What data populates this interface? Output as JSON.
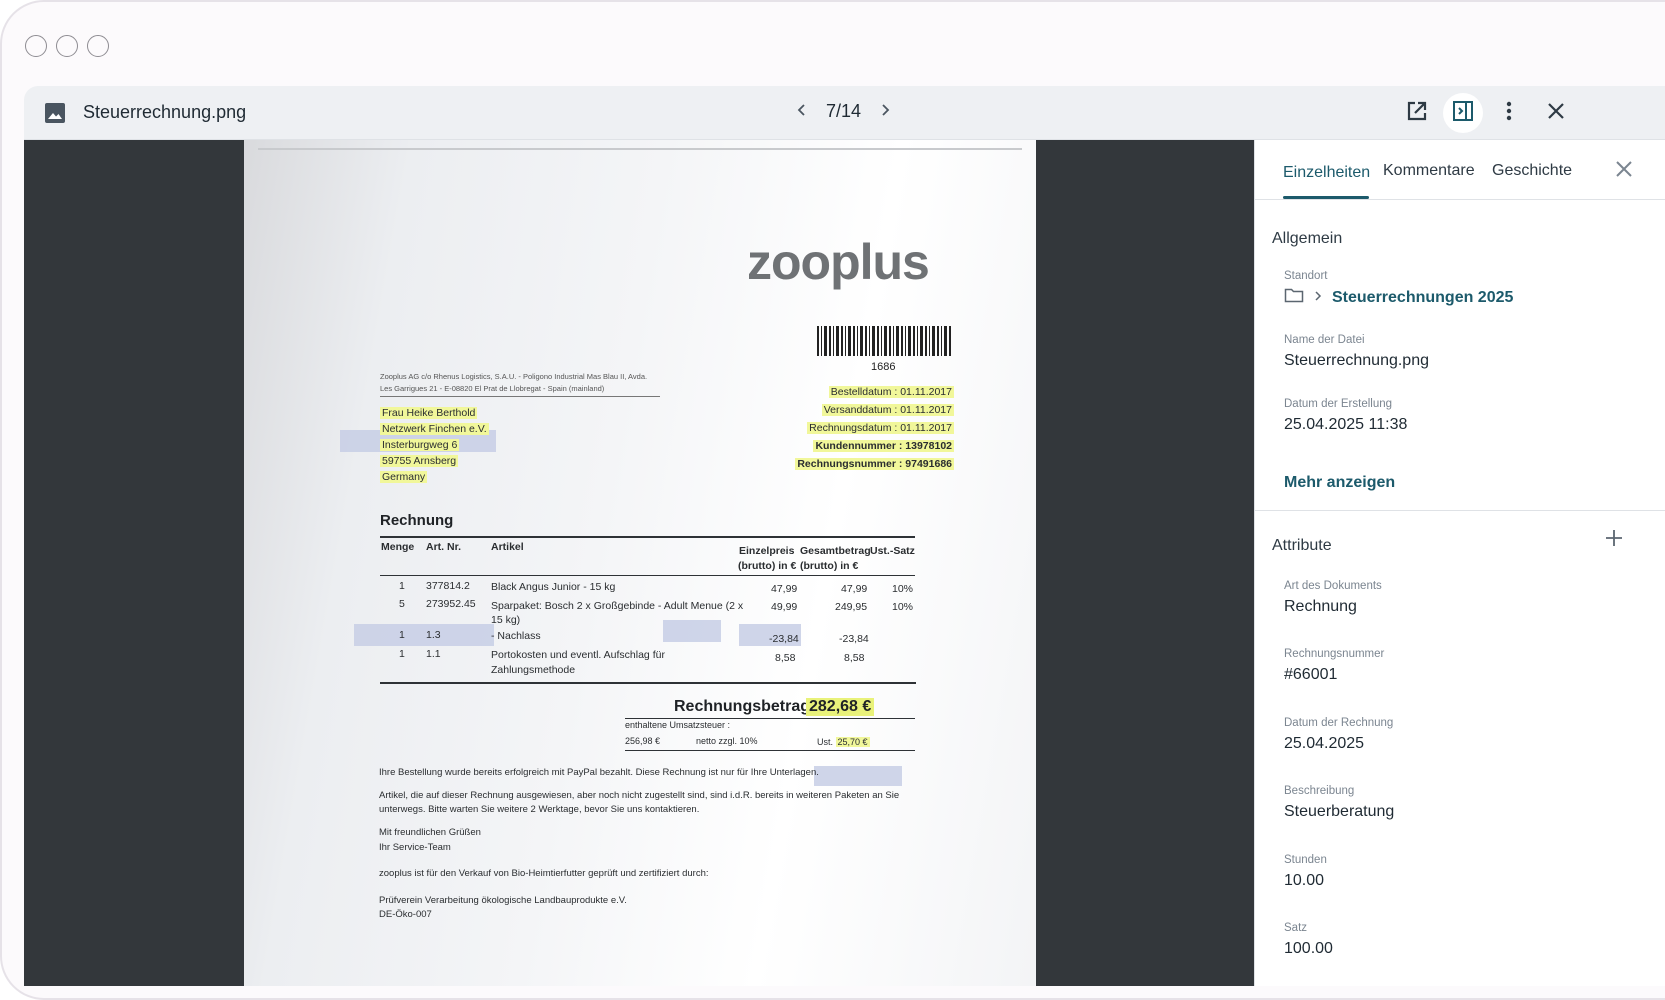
{
  "window": {
    "file_name": "Steuerrechnung.png",
    "pager": "7/14",
    "icons": [
      "image-icon",
      "chevron-left-icon",
      "chevron-right-icon",
      "open-external-icon",
      "sidebar-panel-icon",
      "more-vertical-icon",
      "close-icon"
    ]
  },
  "document": {
    "logo_text": "zooplus",
    "barcode_number": "1686",
    "sender_line1": "Zooplus AG c/o Rhenus Logistics, S.A.U. - Poligono Industrial Mas Blau II, Avda.",
    "sender_line2": "Les Garrigues 21 - E-08820 El Prat de Llobregat - Spain (mainland)",
    "address": [
      "Frau Heike Berthold",
      "Netzwerk Finchen e.V.",
      "Insterburgweg 6",
      "59755 Arnsberg",
      "Germany"
    ],
    "meta": [
      {
        "label": "Bestelldatum :",
        "value": "01.11.2017"
      },
      {
        "label": "Versanddatum :",
        "value": "01.11.2017"
      },
      {
        "label": "Rechnungsdatum :",
        "value": "01.11.2017"
      },
      {
        "label": "Kundennummer :",
        "value": "13978102"
      },
      {
        "label": "Rechnungsnummer :",
        "value": "97491686"
      }
    ],
    "heading": "Rechnung",
    "table_headers": [
      "Menge",
      "Art. Nr.",
      "Artikel",
      "Einzelpreis",
      "(brutto) in €",
      "Gesamtbetrag",
      "(brutto) in €",
      "Ust.-Satz"
    ],
    "rows": [
      {
        "menge": "1",
        "artnr": "377814.2",
        "artikel": "Black Angus Junior - 15 kg",
        "artikel2": "",
        "einzel": "47,99",
        "gesamt": "47,99",
        "ust": "10%"
      },
      {
        "menge": "5",
        "artnr": "273952.45",
        "artikel": "Sparpaket: Bosch 2 x Großgebinde - Adult Menue (2 x",
        "artikel2": "15 kg)",
        "einzel": "49,99",
        "gesamt": "249,95",
        "ust": "10%"
      },
      {
        "menge": "1",
        "artnr": "1.3",
        "artikel": "- Nachlass",
        "artikel2": "",
        "einzel": "-23,84",
        "gesamt": "-23,84",
        "ust": ""
      },
      {
        "menge": "1",
        "artnr": "1.1",
        "artikel": "Portokosten und eventl. Aufschlag für",
        "artikel2": "Zahlungsmethode",
        "einzel": "8,58",
        "gesamt": "8,58",
        "ust": ""
      }
    ],
    "total_label": "Rechnungsbetrag",
    "total_value": "282,68 €",
    "tax_label": "enthaltene Umsatzsteuer :",
    "tax_net": "256,98 €",
    "tax_rate": "netto zzgl. 10%",
    "tax_ust_label": "Ust.",
    "tax_ust_value": "25,70 €",
    "paragraphs": [
      "Ihre Bestellung wurde bereits erfolgreich mit PayPal bezahlt. Diese Rechnung ist nur für Ihre Unterlagen.",
      "Artikel, die auf dieser Rechnung ausgewiesen, aber noch nicht zugestellt sind, sind i.d.R. bereits in weiteren Paketen an Sie",
      "unterwegs. Bitte warten Sie weitere 2 Werktage, bevor Sie uns kontaktieren.",
      "Mit freundlichen Grüßen",
      "Ihr Service-Team",
      "zooplus ist für den Verkauf von Bio-Heimtierfutter geprüft und zertifiziert durch:",
      "Prüfverein Verarbeitung ökologische Landbauprodukte e.V.",
      "DE-Öko-007"
    ]
  },
  "sidebar": {
    "tabs": [
      "Einzelheiten",
      "Kommentare",
      "Geschichte"
    ],
    "general_title": "Allgemein",
    "location_label": "Standort",
    "location_value": "Steuerrechnungen 2025",
    "filename_label": "Name der Datei",
    "filename_value": "Steuerrechnung.png",
    "created_label": "Datum der Erstellung",
    "created_value": "25.04.2025 11:38",
    "more_link": "Mehr anzeigen",
    "attributes_title": "Attribute",
    "attributes": [
      {
        "label": "Art des Dokuments",
        "value": "Rechnung"
      },
      {
        "label": "Rechnungsnummer",
        "value": "#66001"
      },
      {
        "label": "Datum der Rechnung",
        "value": "25.04.2025"
      },
      {
        "label": "Beschreibung",
        "value": "Steuerberatung"
      },
      {
        "label": "Stunden",
        "value": "10.00"
      },
      {
        "label": "Satz",
        "value": "100.00"
      }
    ]
  },
  "colors": {
    "accent": "#1c5a6b",
    "viewer_bg": "#33373b",
    "highlight": "#f1f79a"
  }
}
